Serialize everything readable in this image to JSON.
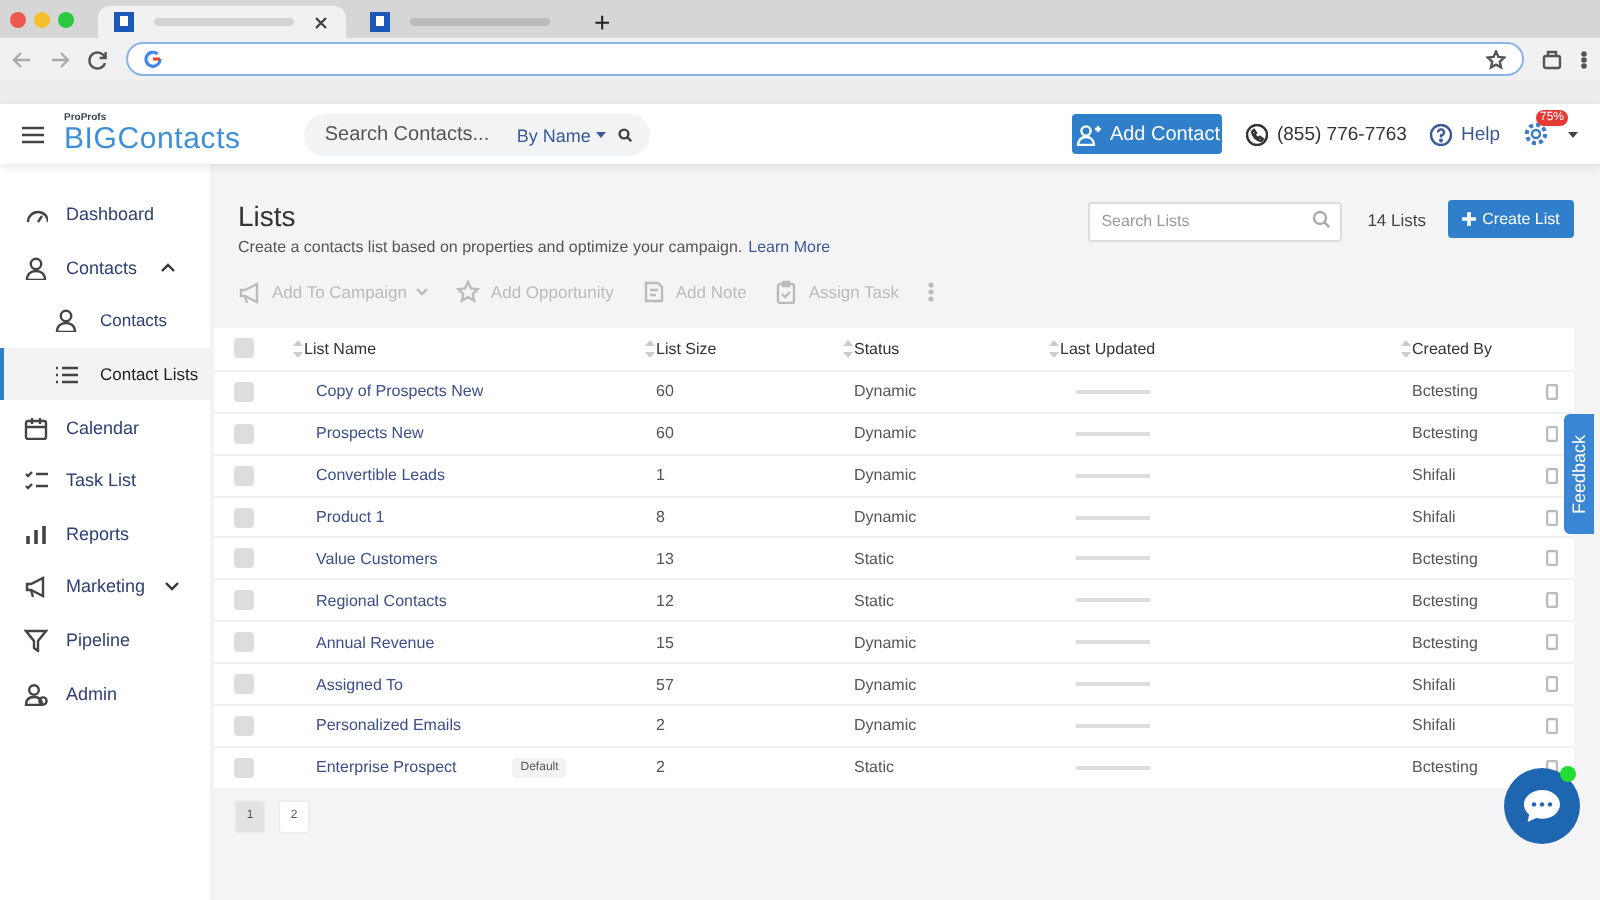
{
  "browser": {
    "tabs": [
      {
        "selected": true
      },
      {
        "selected": false
      }
    ],
    "new_tab": "+"
  },
  "header": {
    "logo_small": "ProProfs",
    "logo": "BIGContacts",
    "search": {
      "placeholder": "Search Contacts...",
      "filter": "By Name"
    },
    "add_button": "Add Contact",
    "phone": "(855) 776-7763",
    "help": "Help",
    "badge": "75%"
  },
  "sidebar": {
    "items": [
      {
        "label": "Dashboard",
        "kind": "gauge",
        "selected": false
      },
      {
        "label": "Contacts",
        "kind": "person",
        "selected": false,
        "expanded": true,
        "children": [
          {
            "label": "Contacts",
            "kind": "person",
            "selected": false
          },
          {
            "label": "Contact Lists",
            "kind": "list",
            "selected": true
          }
        ]
      },
      {
        "label": "Calendar",
        "kind": "calendar",
        "selected": false
      },
      {
        "label": "Task List",
        "kind": "tasks",
        "selected": false
      },
      {
        "label": "Reports",
        "kind": "bars",
        "selected": false
      },
      {
        "label": "Marketing",
        "kind": "megaphone",
        "selected": false,
        "expanded": false
      },
      {
        "label": "Pipeline",
        "kind": "funnel",
        "selected": false
      },
      {
        "label": "Admin",
        "kind": "people",
        "selected": false
      }
    ]
  },
  "page": {
    "title": "Lists",
    "subtitle": "Create a contacts list based on properties and optimize your campaign.",
    "link": "Learn More",
    "search": {
      "placeholder": "Search Lists"
    },
    "count": "14 Lists",
    "create_button": "Create List"
  },
  "toolbar": [
    {
      "label": "Add To Campaign",
      "kind": "megaphone",
      "dropdown": true
    },
    {
      "label": "Add Opportunity",
      "kind": "star",
      "dropdown": false
    },
    {
      "label": "Add Note",
      "kind": "note",
      "dropdown": false
    },
    {
      "label": "Assign Task",
      "kind": "clipboard",
      "dropdown": false
    }
  ],
  "table": {
    "select_all": {
      "checked": false
    },
    "columns": [
      "List Name",
      "List Size",
      "Status",
      "Last Updated",
      "Created By"
    ],
    "rows": [
      {
        "checked": false,
        "name": "Copy of Prospects New",
        "size": "60",
        "status": "Dynamic",
        "created_by": "Bctesting"
      },
      {
        "checked": false,
        "name": "Prospects New",
        "size": "60",
        "status": "Dynamic",
        "created_by": "Bctesting"
      },
      {
        "checked": false,
        "name": "Convertible Leads",
        "size": "1",
        "status": "Dynamic",
        "created_by": "Shifali"
      },
      {
        "checked": false,
        "name": "Product 1",
        "size": "8",
        "status": "Dynamic",
        "created_by": "Shifali"
      },
      {
        "checked": false,
        "name": "Value Customers",
        "size": "13",
        "status": "Static",
        "created_by": "Bctesting"
      },
      {
        "checked": false,
        "name": "Regional Contacts",
        "size": "12",
        "status": "Static",
        "created_by": "Bctesting"
      },
      {
        "checked": false,
        "name": "Annual Revenue",
        "size": "15",
        "status": "Dynamic",
        "created_by": "Bctesting"
      },
      {
        "checked": false,
        "name": "Assigned To",
        "size": "57",
        "status": "Dynamic",
        "created_by": "Shifali"
      },
      {
        "checked": false,
        "name": "Personalized Emails",
        "size": "2",
        "status": "Dynamic",
        "created_by": "Shifali"
      },
      {
        "checked": false,
        "name": "Enterprise Prospect",
        "badge": "Default",
        "size": "2",
        "status": "Static",
        "created_by": "Bctesting"
      }
    ]
  },
  "pagination": [
    {
      "label": "1",
      "selected": true
    },
    {
      "label": "2",
      "selected": false
    }
  ],
  "feedback": "Feedback"
}
